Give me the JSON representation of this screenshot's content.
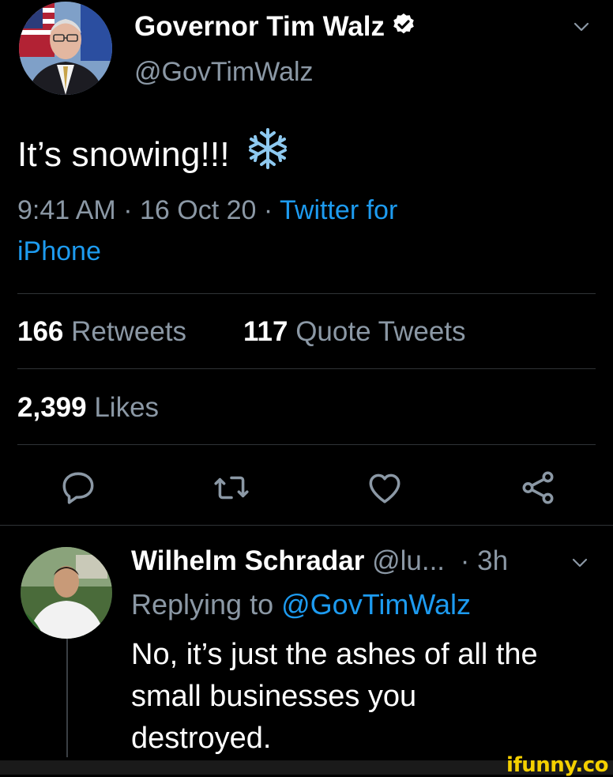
{
  "tweet": {
    "display_name": "Governor Tim Walz",
    "handle": "@GovTimWalz",
    "text": "It’s snowing!!!",
    "emoji": "❄️",
    "time": "9:41 AM",
    "dot1": "·",
    "date": "16 Oct 20",
    "dot2": "·",
    "source_line1": "Twitter for",
    "source_line2": "iPhone",
    "retweets_count": "166",
    "retweets_label": "Retweets",
    "quotes_count": "117",
    "quotes_label": "Quote Tweets",
    "likes_count": "2,399",
    "likes_label": "Likes"
  },
  "reply": {
    "display_name": "Wilhelm Schradar",
    "handle": "@lu...",
    "time": "· 3h",
    "replying_prefix": "Replying to",
    "replying_handle": "@GovTimWalz",
    "text_line1": "No, it’s just the ashes of all the",
    "text_line2": "small businesses you",
    "text_line3": "destroyed."
  },
  "watermark": "ifunny.co",
  "colors": {
    "background": "#000000",
    "muted": "#8b98a5",
    "link": "#1d9bf0",
    "divider": "#2f3336",
    "watermark": "#f5d000"
  },
  "icons": [
    "verified-badge-icon",
    "chevron-down-icon",
    "reply-icon",
    "retweet-icon",
    "like-icon",
    "share-icon",
    "snowflake-emoji"
  ]
}
